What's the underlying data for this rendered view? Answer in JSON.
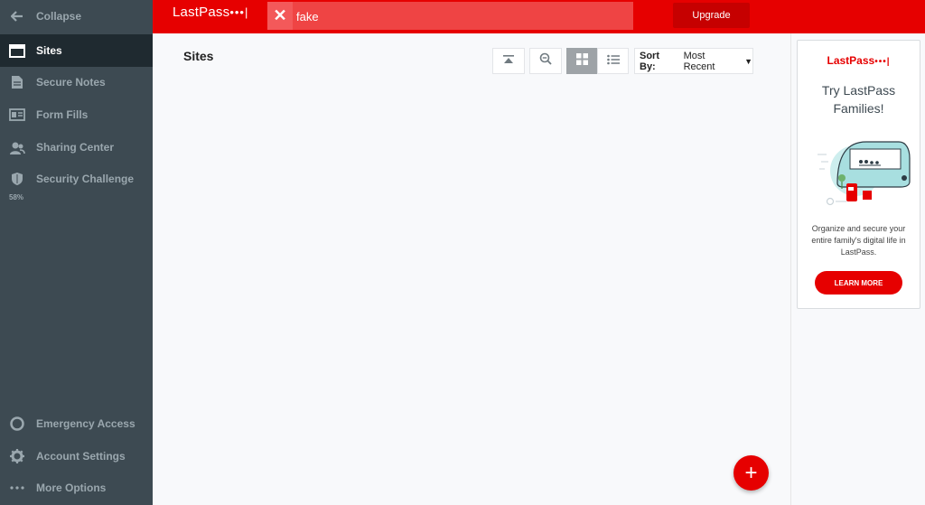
{
  "sidebar": {
    "items": [
      {
        "label": "Collapse",
        "icon": "arrow-left-icon"
      },
      {
        "label": "Sites",
        "icon": "browser-window-icon"
      },
      {
        "label": "Secure Notes",
        "icon": "note-icon"
      },
      {
        "label": "Form Fills",
        "icon": "id-card-icon"
      },
      {
        "label": "Sharing Center",
        "icon": "users-icon"
      },
      {
        "label": "Security Challenge",
        "icon": "shield-icon",
        "score": "58%"
      },
      {
        "label": "Emergency Access",
        "icon": "lifebuoy-icon"
      },
      {
        "label": "Account Settings",
        "icon": "gear-icon"
      },
      {
        "label": "More Options",
        "icon": "ellipsis-icon"
      }
    ]
  },
  "header": {
    "logo_text": "LastPass",
    "logo_dots": "•••|",
    "search_value": "fake",
    "upgrade_label": "Upgrade"
  },
  "main": {
    "title": "Sites",
    "sort_label": "Sort By:",
    "sort_value": "Most Recent"
  },
  "promo": {
    "logo_text": "LastPass",
    "logo_dots": "•••|",
    "title": "Try LastPass Families!",
    "text": "Organize and secure your entire family's digital life in LastPass.",
    "button": "LEARN MORE"
  },
  "colors": {
    "brand": "#e60000",
    "sidebar_bg": "#3d4a52",
    "sidebar_active": "#1f2a30"
  }
}
